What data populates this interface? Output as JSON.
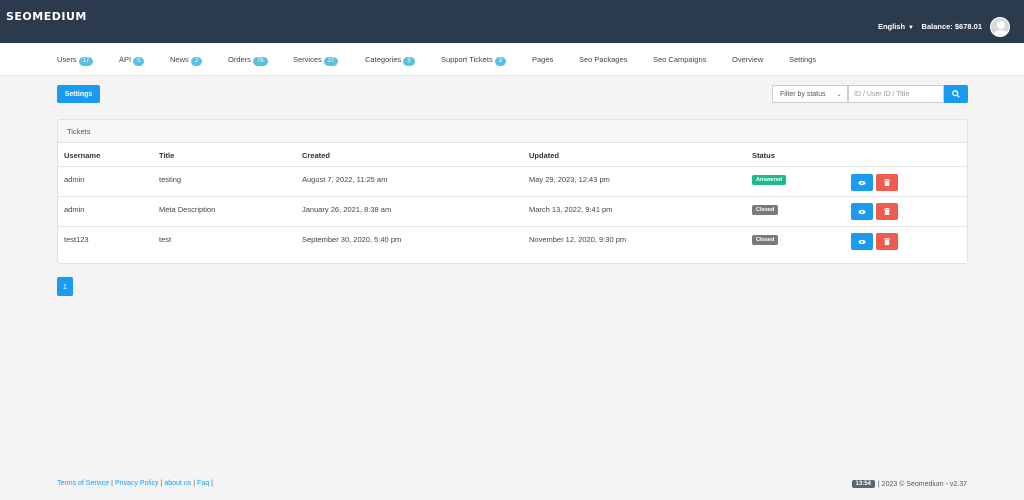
{
  "header": {
    "brand": "SEOMEDIUM",
    "language": "English",
    "balance": "Balance: $678.01"
  },
  "nav": [
    {
      "label": "Users",
      "count": "17"
    },
    {
      "label": "API",
      "count": "0"
    },
    {
      "label": "News",
      "count": "2"
    },
    {
      "label": "Orders",
      "count": "76"
    },
    {
      "label": "Services",
      "count": "27"
    },
    {
      "label": "Categories",
      "count": "3"
    },
    {
      "label": "Support Tickets",
      "count": "3"
    },
    {
      "label": "Pages",
      "count": ""
    },
    {
      "label": "Seo Packages",
      "count": ""
    },
    {
      "label": "Seo Campaigns",
      "count": ""
    },
    {
      "label": "Overview",
      "count": ""
    },
    {
      "label": "Settings",
      "count": ""
    }
  ],
  "toolbar": {
    "settings_label": "Settings",
    "filter_label": "Filter by status",
    "search_placeholder": "ID / User ID / Title"
  },
  "panel": {
    "title": "Tickets",
    "columns": [
      "Username",
      "Title",
      "Created",
      "Updated",
      "Status"
    ],
    "rows": [
      {
        "username": "admin",
        "title": "testing",
        "created": "August 7, 2022, 11:25 am",
        "updated": "May 29, 2023, 12:43 pm",
        "status": "Answered"
      },
      {
        "username": "admin",
        "title": "Meta Description",
        "created": "January 26, 2021, 8:38 am",
        "updated": "March 13, 2022, 9:41 pm",
        "status": "Closed"
      },
      {
        "username": "test123",
        "title": "test",
        "created": "September 30, 2020, 5:40 pm",
        "updated": "November 12, 2020, 9:30 pm",
        "status": "Closed"
      }
    ]
  },
  "pagination": {
    "current": "1"
  },
  "footer": {
    "links": [
      "Terms of Service",
      "Privacy Policy",
      "about us",
      "Faq"
    ],
    "time": "13:54",
    "copyright": "2023 © Seomedium - v2.37"
  },
  "colors": {
    "primary": "#1a9bf0",
    "danger": "#f05b4f",
    "answered": "#1cbb8c",
    "closed": "#7a7a7a",
    "topbar": "#2b3a4c"
  },
  "icons": {
    "search": "search-icon",
    "view": "eye-icon",
    "delete": "trash-icon",
    "avatar": "user-avatar-icon"
  }
}
